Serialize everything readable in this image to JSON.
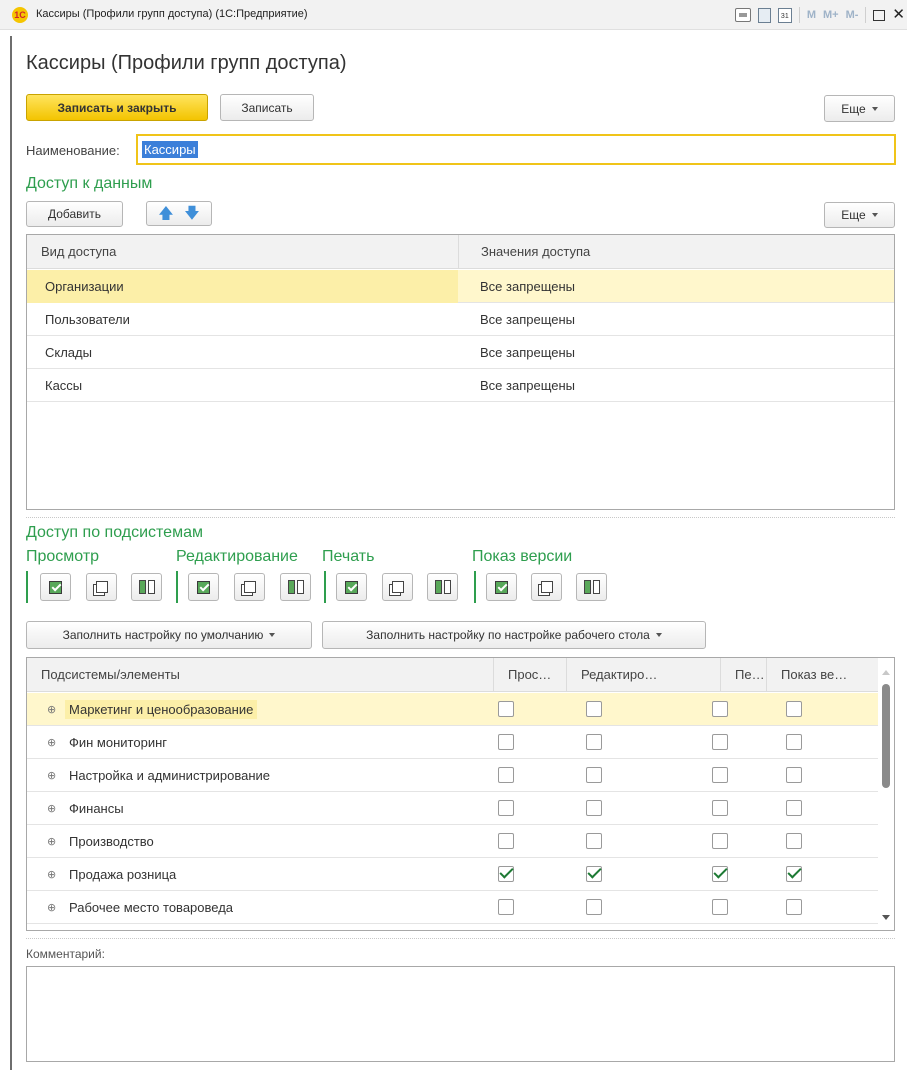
{
  "window": {
    "logo": "1C",
    "title": "Кассиры (Профили групп доступа)  (1С:Предприятие)",
    "toolbar_icons": [
      "print-icon",
      "calculator-icon",
      "calendar-icon"
    ],
    "memory_labels": [
      "M",
      "M+",
      "M-"
    ],
    "calendar_day": "31"
  },
  "form": {
    "title": "Кассиры (Профили групп доступа)",
    "save_close_label": "Записать и закрыть",
    "save_label": "Записать",
    "more_label": "Еще"
  },
  "name_field": {
    "label": "Наименование:",
    "value": "Кассиры"
  },
  "data_access": {
    "section_title": "Доступ к данным",
    "add_label": "Добавить",
    "more_label": "Еще",
    "columns": [
      "Вид доступа",
      "Значения доступа"
    ],
    "rows": [
      {
        "kind": "Организации",
        "value": "Все запрещены",
        "selected": true
      },
      {
        "kind": "Пользователи",
        "value": "Все запрещены",
        "selected": false
      },
      {
        "kind": "Склады",
        "value": "Все запрещены",
        "selected": false
      },
      {
        "kind": "Кассы",
        "value": "Все запрещены",
        "selected": false
      }
    ]
  },
  "subsystems": {
    "section_title": "Доступ по подсистемам",
    "rights_groups": [
      "Просмотр",
      "Редактирование",
      "Печать",
      "Показ версии"
    ],
    "fill_default_label": "Заполнить настройку по умолчанию",
    "fill_desktop_label": "Заполнить настройку по настройке рабочего стола",
    "columns": [
      "Подсистемы/элементы",
      "Прос…",
      "Редактиро…",
      "Пе…",
      "Показ ве…"
    ],
    "rows": [
      {
        "name": "Маркетинг и ценообразование",
        "view": false,
        "edit": false,
        "print": false,
        "version": false,
        "selected": true
      },
      {
        "name": "Фин мониторинг",
        "view": false,
        "edit": false,
        "print": false,
        "version": false,
        "selected": false
      },
      {
        "name": "Настройка и администрирование",
        "view": false,
        "edit": false,
        "print": false,
        "version": false,
        "selected": false
      },
      {
        "name": "Финансы",
        "view": false,
        "edit": false,
        "print": false,
        "version": false,
        "selected": false
      },
      {
        "name": "Производство",
        "view": false,
        "edit": false,
        "print": false,
        "version": false,
        "selected": false
      },
      {
        "name": "Продажа розница",
        "view": true,
        "edit": true,
        "print": true,
        "version": true,
        "selected": false
      },
      {
        "name": "Рабочее место товароведа",
        "view": false,
        "edit": false,
        "print": false,
        "version": false,
        "selected": false
      }
    ]
  },
  "comment": {
    "label": "Комментарий:",
    "value": ""
  },
  "colors": {
    "accent_yellow": "#f3c400",
    "section_green": "#2e9e4e",
    "selected_row": "#fff7cc",
    "selection_blue": "#3b7fd9"
  }
}
